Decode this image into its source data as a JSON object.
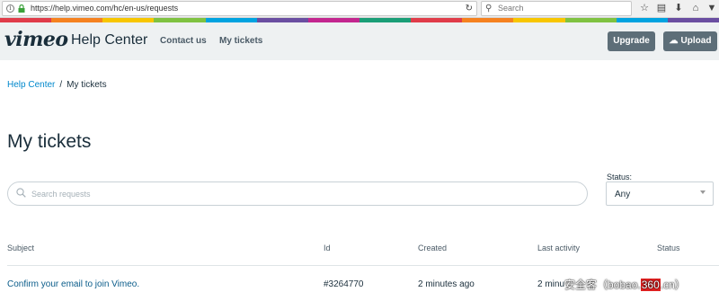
{
  "browser": {
    "url": "https://help.vimeo.com/hc/en-us/requests",
    "search_placeholder": "Search"
  },
  "header": {
    "logo": "vimeo",
    "help_center": "Help Center",
    "nav": [
      "Contact us",
      "My tickets"
    ],
    "upgrade_label": "Upgrade",
    "upload_label": "Upload"
  },
  "breadcrumb": {
    "home": "Help Center",
    "separator": "/",
    "current": "My tickets"
  },
  "page_title": "My tickets",
  "search": {
    "placeholder": "Search requests"
  },
  "status_filter": {
    "label": "Status:",
    "selected": "Any"
  },
  "table": {
    "headers": [
      "Subject",
      "Id",
      "Created",
      "Last activity",
      "Status"
    ],
    "rows": [
      {
        "subject": "Confirm your email to join Vimeo.",
        "id": "#3264770",
        "created": "2 minutes ago",
        "last_activity": "2 minu",
        "status": ""
      }
    ]
  },
  "watermark": {
    "prefix": "安全客（bobao.",
    "highlight": "360",
    "suffix": ".cn）"
  },
  "colors": {
    "accent": "#0088cc",
    "button": "#5d6e78",
    "header_bg": "#eef1f2",
    "stripe": [
      "#e03c4a",
      "#f58220",
      "#f7c600",
      "#7fc241",
      "#00a3e0",
      "#6a4ea1",
      "#c3268f",
      "#1a9e77",
      "#e03c4a",
      "#f58220",
      "#f7c600",
      "#7fc241",
      "#00a3e0",
      "#6a4ea1"
    ]
  }
}
